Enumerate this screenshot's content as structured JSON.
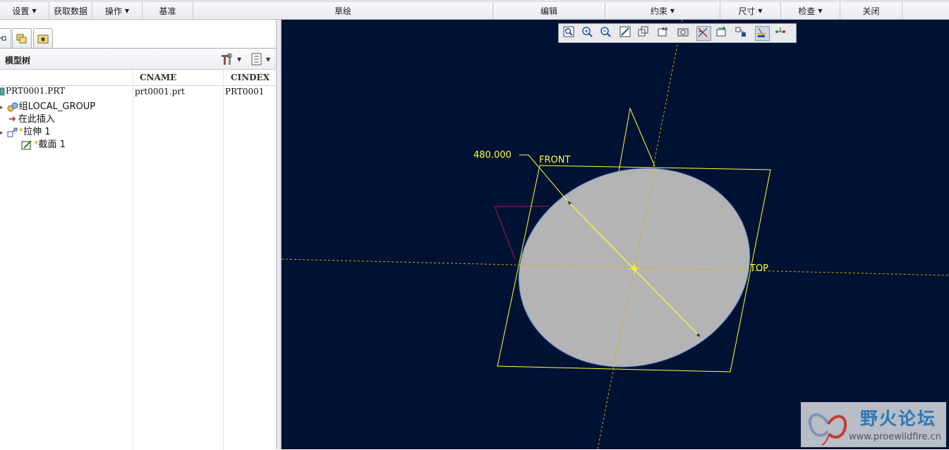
{
  "ribbon": {
    "groups": [
      {
        "label": "设置",
        "dropdown": true
      },
      {
        "label": "获取数据",
        "dropdown": false
      },
      {
        "label": "操作",
        "dropdown": true
      },
      {
        "label": "基准",
        "dropdown": false
      },
      {
        "label": "草绘",
        "dropdown": false
      },
      {
        "label": "编辑",
        "dropdown": false
      },
      {
        "label": "约束",
        "dropdown": true
      },
      {
        "label": "尺寸",
        "dropdown": true
      },
      {
        "label": "检查",
        "dropdown": true
      },
      {
        "label": "关闭",
        "dropdown": false
      }
    ],
    "caret": "▼"
  },
  "model_tree": {
    "title": "模型树",
    "columns": {
      "cname": "CNAME",
      "cindex": "CINDEX"
    },
    "rows": [
      {
        "name": "PRT0001.PRT",
        "cname": "prt0001.prt",
        "cindex": "PRT0001"
      },
      {
        "name": "组LOCAL_GROUP"
      },
      {
        "name": "在此插入"
      },
      {
        "name": "拉伸 1",
        "modified_mark": "*"
      },
      {
        "name": "截面 1",
        "modified_mark": "*"
      }
    ],
    "expander": "▸"
  },
  "graphics": {
    "dimension_label": "480.000",
    "datum_front": "FRONT",
    "datum_top": "TOP",
    "colors": {
      "background": "#001233",
      "ellipse_fill": "#b4b4b4",
      "datum_yellow": "#ffff33",
      "axis_orange": "#d9a800",
      "plane_magenta": "#b0184a"
    }
  },
  "view_toolbar": {
    "icons": [
      "refit-icon",
      "zoom-in-icon",
      "zoom-out-icon",
      "repaint-icon",
      "display-style-icon",
      "saved-views-icon",
      "camera-icon",
      "constraint-display-icon",
      "dimension-display-icon",
      "vertex-display-icon",
      "grid-icon",
      "sketch-view-icon",
      "datum-points-icon"
    ]
  },
  "watermark": {
    "name": "野火论坛",
    "url": "www.proewildfire.cn"
  }
}
